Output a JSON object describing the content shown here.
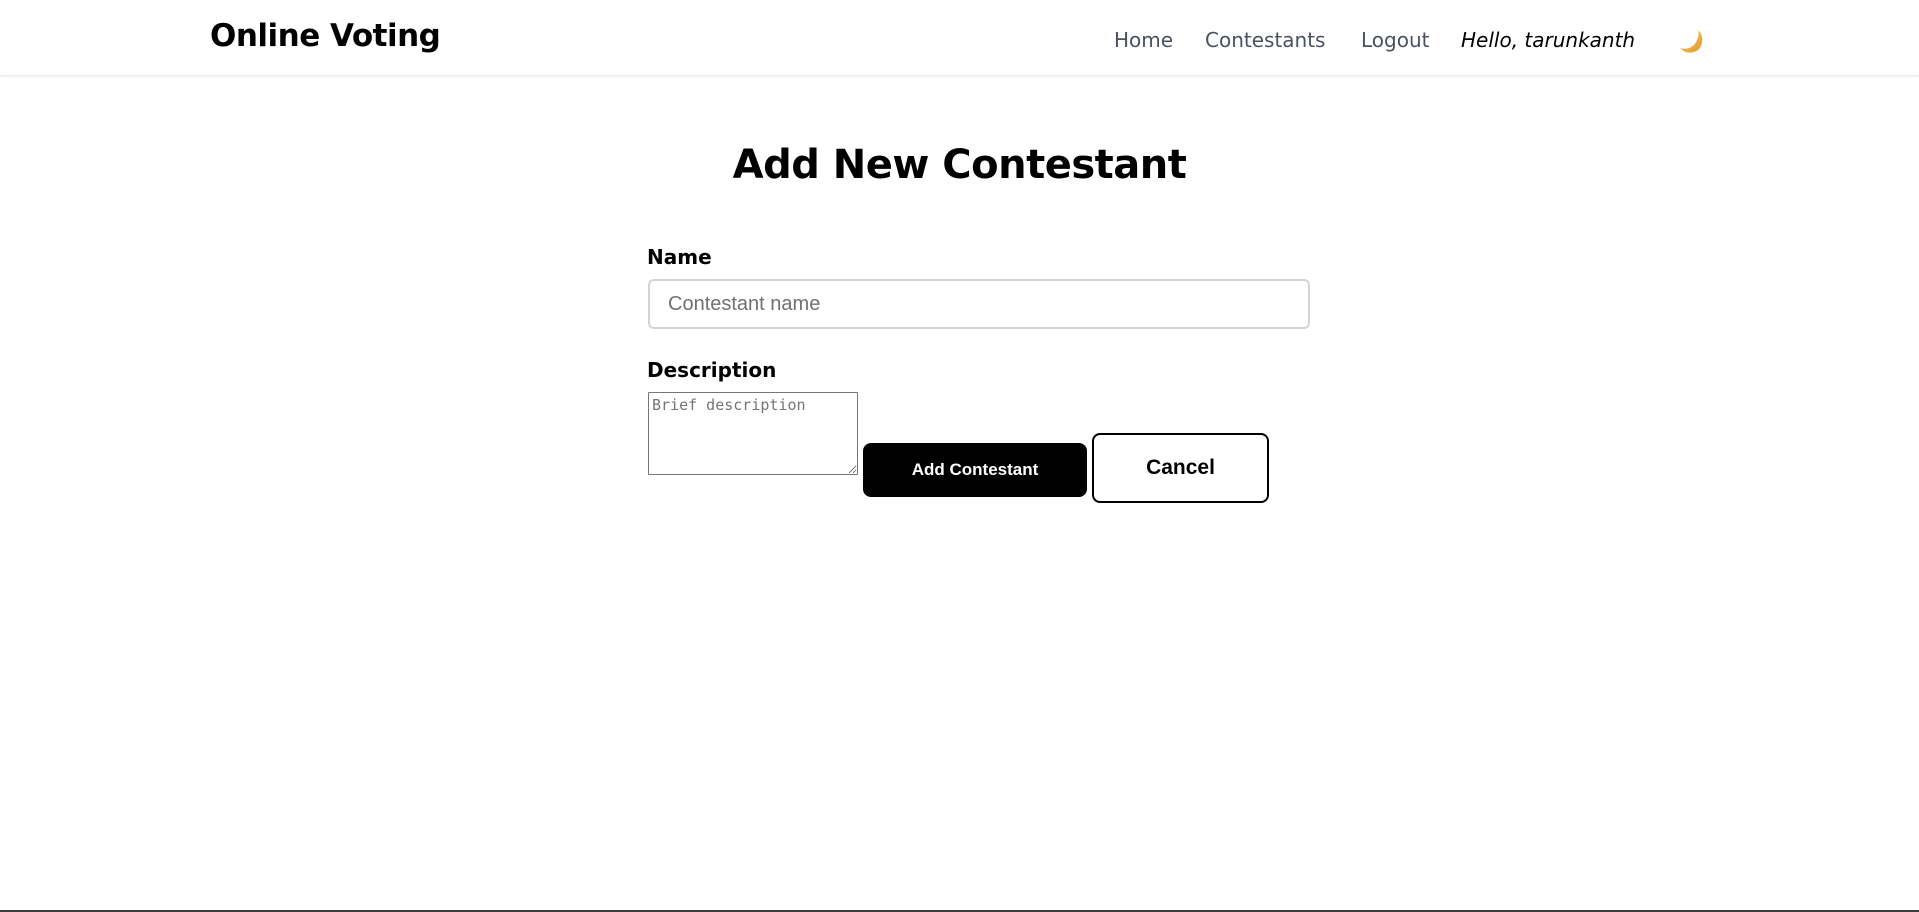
{
  "navbar": {
    "brand": "Online Voting",
    "links": [
      {
        "label": "Home"
      },
      {
        "label": "Contestants"
      },
      {
        "label": "Logout"
      }
    ],
    "greeting": "Hello, tarunkanth",
    "theme_toggle_icon": "crescent-moon-icon"
  },
  "page": {
    "title": "Add New Contestant"
  },
  "form": {
    "name_label": "Name",
    "name_placeholder": "Contestant name",
    "name_value": "",
    "description_label": "Description",
    "description_placeholder": "Brief description",
    "description_value": "",
    "submit_label": "Add Contestant",
    "cancel_label": "Cancel"
  },
  "colors": {
    "primary": "#000000",
    "nav_link": "#4a5160",
    "moon": "#f2b24a"
  }
}
